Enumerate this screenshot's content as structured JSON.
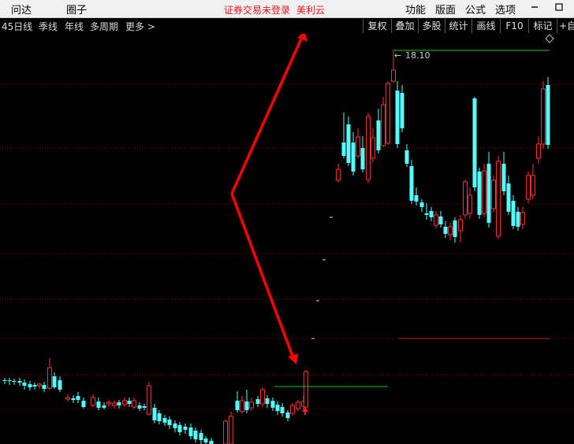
{
  "menubar": {
    "left_items": [
      "问达",
      "圈子"
    ],
    "notice": "证券交易未登录",
    "brand": "美利云",
    "right_items": [
      "功能",
      "版面",
      "公式",
      "选项"
    ]
  },
  "toolbar": {
    "periods": [
      "45日线",
      "季线",
      "年线",
      "多周期",
      "更多 >"
    ],
    "buttons": [
      "复权",
      "叠加",
      "多股",
      "统计",
      "画线",
      "F10",
      "标记",
      "+自选"
    ]
  },
  "chart": {
    "high_label": "18.10",
    "colors": {
      "up": "#ff3030",
      "down": "#54ffff",
      "arrow": "#ff0000",
      "grid": "#8a0000",
      "support": "#22c322",
      "resistance": "#d02020"
    },
    "icons": [
      "diamond-icon",
      "arrow-annotation-icon"
    ]
  }
}
